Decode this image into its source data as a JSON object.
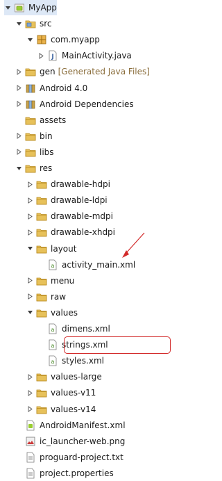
{
  "tree": [
    {
      "label": "MyApp",
      "indent": 0,
      "toggle": "open",
      "icon": "android-project-icon"
    },
    {
      "label": "src",
      "indent": 1,
      "toggle": "open",
      "icon": "source-folder-icon"
    },
    {
      "label": "com.myapp",
      "indent": 2,
      "toggle": "open",
      "icon": "package-icon"
    },
    {
      "label": "MainActivity.java",
      "indent": 3,
      "toggle": "closed",
      "icon": "java-file-icon"
    },
    {
      "label": "gen",
      "decoration": "[Generated Java Files]",
      "indent": 1,
      "toggle": "closed",
      "icon": "gen-folder-icon"
    },
    {
      "label": "Android 4.0",
      "indent": 1,
      "toggle": "closed",
      "icon": "library-icon"
    },
    {
      "label": "Android Dependencies",
      "indent": 1,
      "toggle": "closed",
      "icon": "library-icon"
    },
    {
      "label": "assets",
      "indent": 1,
      "toggle": "none",
      "icon": "folder-icon"
    },
    {
      "label": "bin",
      "indent": 1,
      "toggle": "closed",
      "icon": "folder-icon"
    },
    {
      "label": "libs",
      "indent": 1,
      "toggle": "closed",
      "icon": "folder-icon"
    },
    {
      "label": "res",
      "indent": 1,
      "toggle": "open",
      "icon": "folder-icon"
    },
    {
      "label": "drawable-hdpi",
      "indent": 2,
      "toggle": "closed",
      "icon": "folder-icon"
    },
    {
      "label": "drawable-ldpi",
      "indent": 2,
      "toggle": "closed",
      "icon": "folder-icon"
    },
    {
      "label": "drawable-mdpi",
      "indent": 2,
      "toggle": "closed",
      "icon": "folder-icon"
    },
    {
      "label": "drawable-xhdpi",
      "indent": 2,
      "toggle": "closed",
      "icon": "folder-icon"
    },
    {
      "label": "layout",
      "indent": 2,
      "toggle": "open",
      "icon": "folder-icon"
    },
    {
      "label": "activity_main.xml",
      "indent": 3,
      "toggle": "none",
      "icon": "xml-file-icon"
    },
    {
      "label": "menu",
      "indent": 2,
      "toggle": "closed",
      "icon": "folder-icon"
    },
    {
      "label": "raw",
      "indent": 2,
      "toggle": "closed",
      "icon": "folder-icon"
    },
    {
      "label": "values",
      "indent": 2,
      "toggle": "open",
      "icon": "folder-icon"
    },
    {
      "label": "dimens.xml",
      "indent": 3,
      "toggle": "none",
      "icon": "xml-file-icon"
    },
    {
      "label": "strings.xml",
      "indent": 3,
      "toggle": "none",
      "icon": "xml-file-icon",
      "highlight": true
    },
    {
      "label": "styles.xml",
      "indent": 3,
      "toggle": "none",
      "icon": "xml-file-icon"
    },
    {
      "label": "values-large",
      "indent": 2,
      "toggle": "closed",
      "icon": "folder-icon"
    },
    {
      "label": "values-v11",
      "indent": 2,
      "toggle": "closed",
      "icon": "folder-icon"
    },
    {
      "label": "values-v14",
      "indent": 2,
      "toggle": "closed",
      "icon": "folder-icon"
    },
    {
      "label": "AndroidManifest.xml",
      "indent": 1,
      "toggle": "none",
      "icon": "manifest-file-icon"
    },
    {
      "label": "ic_launcher-web.png",
      "indent": 1,
      "toggle": "none",
      "icon": "image-file-icon"
    },
    {
      "label": "proguard-project.txt",
      "indent": 1,
      "toggle": "none",
      "icon": "text-file-icon"
    },
    {
      "label": "project.properties",
      "indent": 1,
      "toggle": "none",
      "icon": "text-file-icon"
    }
  ],
  "colors": {
    "folder": "#e7c15a",
    "folder_dark": "#b98a1f",
    "decoration": "#8a6d3b",
    "callout": "#d22a2a",
    "selection": "#dde8f6"
  }
}
